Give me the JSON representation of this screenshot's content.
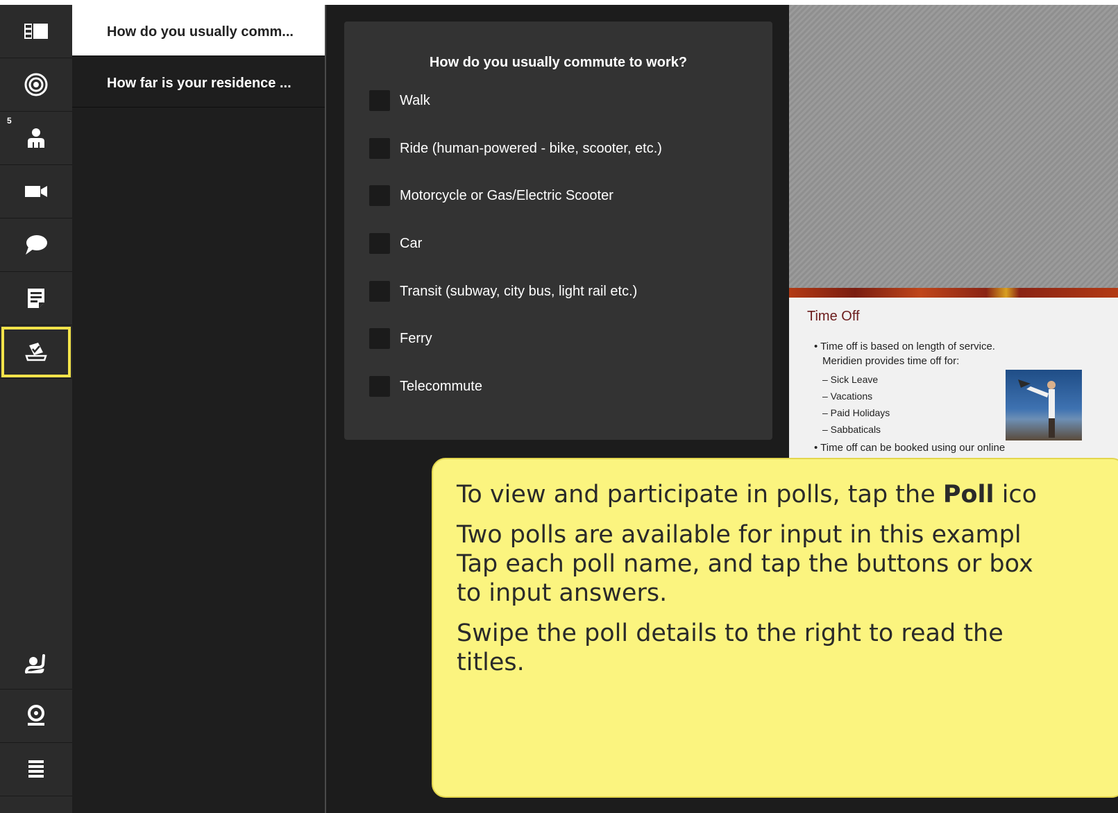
{
  "rail": {
    "items": [
      {
        "icon": "layout-icon"
      },
      {
        "icon": "target-icon"
      },
      {
        "icon": "attendees-icon",
        "badge": "5"
      },
      {
        "icon": "camera-icon"
      },
      {
        "icon": "chat-icon"
      },
      {
        "icon": "notes-icon"
      },
      {
        "icon": "poll-icon",
        "active": true
      },
      {
        "icon": "raise-hand-icon"
      },
      {
        "icon": "webcam-icon"
      },
      {
        "icon": "menu-icon"
      }
    ]
  },
  "poll_list": {
    "items": [
      {
        "label": "How do you usually comm...",
        "selected": true
      },
      {
        "label": "How far is your residence ...",
        "selected": false
      }
    ]
  },
  "poll": {
    "question": "How do you usually commute to work?",
    "options": [
      "Walk",
      "Ride (human-powered - bike, scooter, etc.)",
      "Motorcycle or Gas/Electric Scooter",
      "Car",
      "Transit (subway, city bus, light rail etc.)",
      "Ferry",
      "Telecommute"
    ]
  },
  "slide": {
    "title": "Time Off",
    "bullet1_line1": "• Time off is based on length of service.",
    "bullet1_line2": "Meridien provides time off for:",
    "sub": [
      "– Sick Leave",
      "– Vacations",
      "– Paid Holidays",
      "– Sabbaticals"
    ],
    "bullet2": "• Time off can be booked using our online"
  },
  "tooltip": {
    "line1_pre": "To view and participate in polls, tap the ",
    "line1_bold": "Poll",
    "line1_post": " ico",
    "p2_l1": "Two polls are available for input in this exampl",
    "p2_l2": "Tap each poll name, and tap the buttons or box",
    "p2_l3": "to input answers.",
    "p3_l1": "Swipe the poll details to the right to read the",
    "p3_l2": "titles."
  },
  "colors": {
    "highlight": "#f3e34a",
    "tooltip_bg": "#fbf47f"
  }
}
